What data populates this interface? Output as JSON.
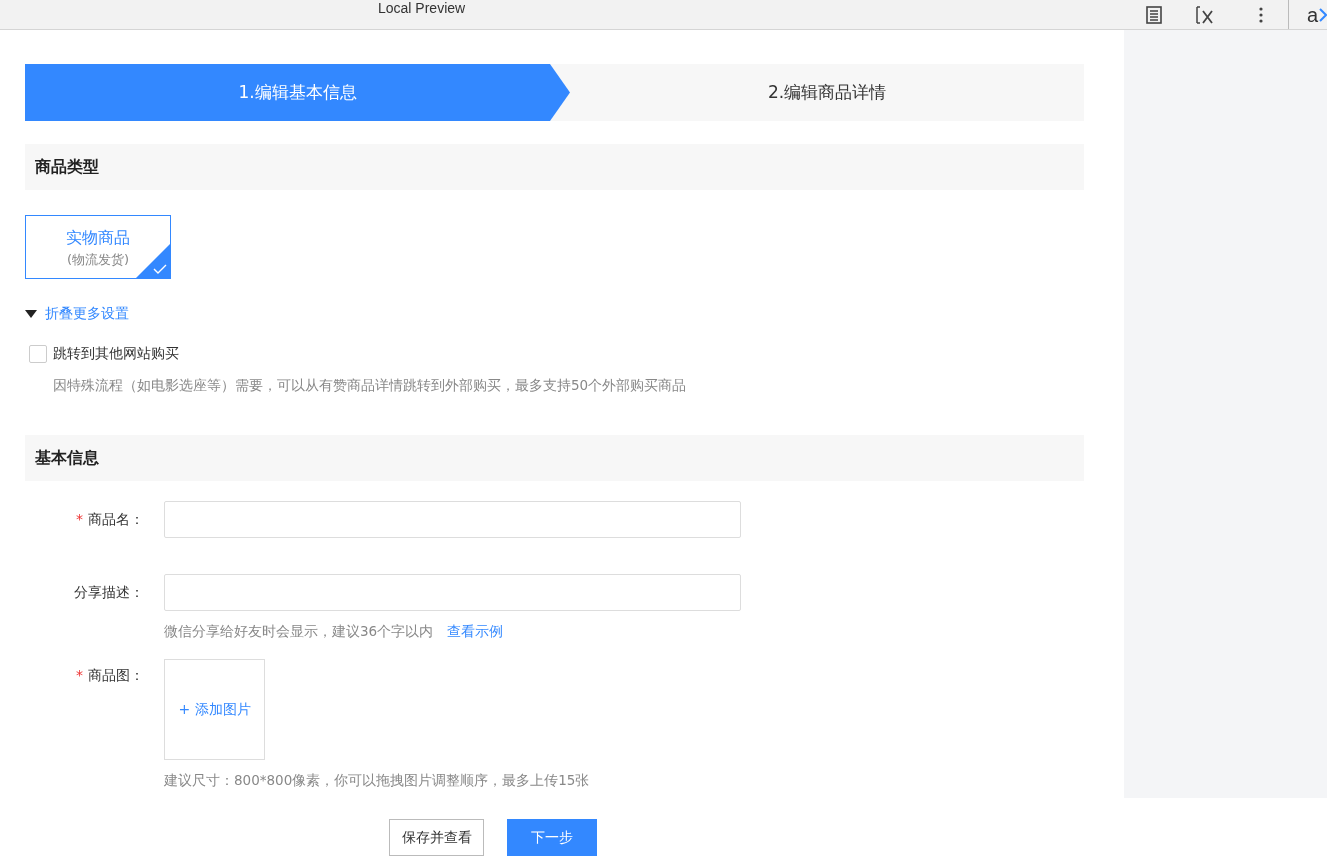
{
  "window": {
    "title": "Local Preview",
    "brand": "a"
  },
  "steps": [
    {
      "label": "1.编辑基本信息",
      "selected": true
    },
    {
      "label": "2.编辑商品详情",
      "selected": false
    }
  ],
  "product_type": {
    "title": "商品类型",
    "options": [
      {
        "title": "实物商品",
        "subtitle": "(物流发货)",
        "selected": true
      }
    ],
    "more_settings": {
      "label": "折叠更多设置",
      "expanded": true
    },
    "redirect": {
      "label": "跳转到其他网站购买",
      "checked": false,
      "hint": "因特殊流程（如电影选座等）需要，可以从有赞商品详情跳转到外部购买，最多支持50个外部购买商品"
    }
  },
  "basic_info": {
    "title": "基本信息",
    "required_mark": "*",
    "fields": [
      {
        "kind": "text",
        "label": "商品名：",
        "required": true
      },
      {
        "kind": "text",
        "label": "分享描述：",
        "required": false,
        "hint": "微信分享给好友时会显示，建议36个字以内",
        "link": "查看示例"
      },
      {
        "kind": "upload",
        "label": "商品图：",
        "required": true,
        "add_label": "+ 添加图片",
        "hint": "建议尺寸：800*800像素，你可以拖拽图片调整顺序，最多上传15张"
      }
    ]
  },
  "buttons": [
    {
      "label": "保存并查看",
      "kind": "secondary"
    },
    {
      "label": "下一步",
      "kind": "primary"
    }
  ]
}
